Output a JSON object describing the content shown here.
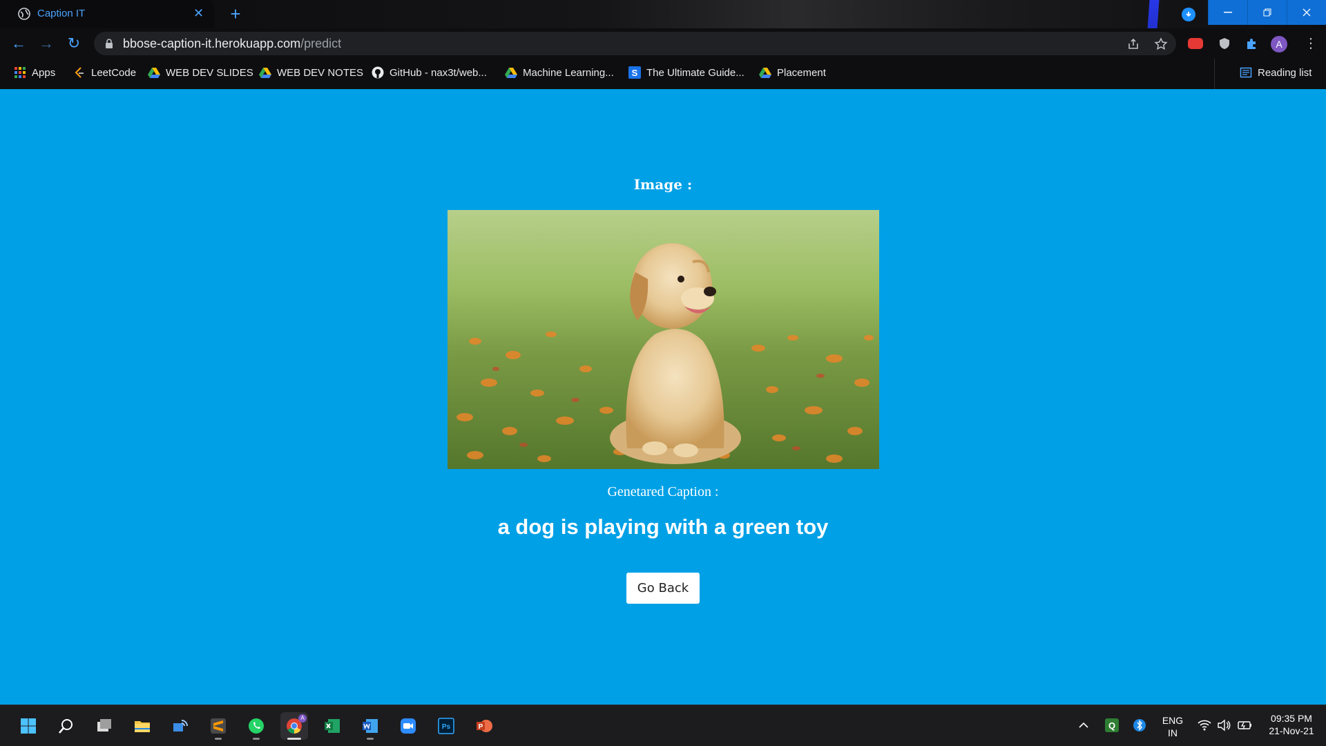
{
  "browser": {
    "tab_title": "Caption IT",
    "url_host": "bbose-caption-it.herokuapp.com",
    "url_path": "/predict",
    "profile_initial": "A"
  },
  "bookmarks": [
    {
      "label": "Apps",
      "icon": "apps-grid-icon"
    },
    {
      "label": "LeetCode",
      "icon": "leetcode-icon"
    },
    {
      "label": "WEB DEV SLIDES",
      "icon": "google-drive-icon"
    },
    {
      "label": "WEB DEV NOTES",
      "icon": "google-drive-icon"
    },
    {
      "label": "GitHub - nax3t/web...",
      "icon": "github-icon"
    },
    {
      "label": "Machine Learning...",
      "icon": "google-drive-icon"
    },
    {
      "label": "The Ultimate Guide...",
      "icon": "s-logo-icon"
    },
    {
      "label": "Placement",
      "icon": "google-drive-icon"
    }
  ],
  "reading_list": "Reading list",
  "page": {
    "image_label": "Image :",
    "image_subject": "golden retriever puppy sitting in grass with orange flowers",
    "caption_label": "Genetared Caption :",
    "caption_text": "a dog is playing with a green toy",
    "go_back_label": "Go Back",
    "background_color": "#00a0e6"
  },
  "taskbar": {
    "apps": [
      "start-icon",
      "search-icon",
      "task-view-icon",
      "file-explorer-icon",
      "connect-icon",
      "sublime-text-icon",
      "whatsapp-icon",
      "chrome-icon",
      "excel-icon",
      "word-icon",
      "zoom-icon",
      "photoshop-icon",
      "powerpoint-icon"
    ],
    "lang_top": "ENG",
    "lang_bottom": "IN",
    "time": "09:35 PM",
    "date": "21-Nov-21"
  }
}
